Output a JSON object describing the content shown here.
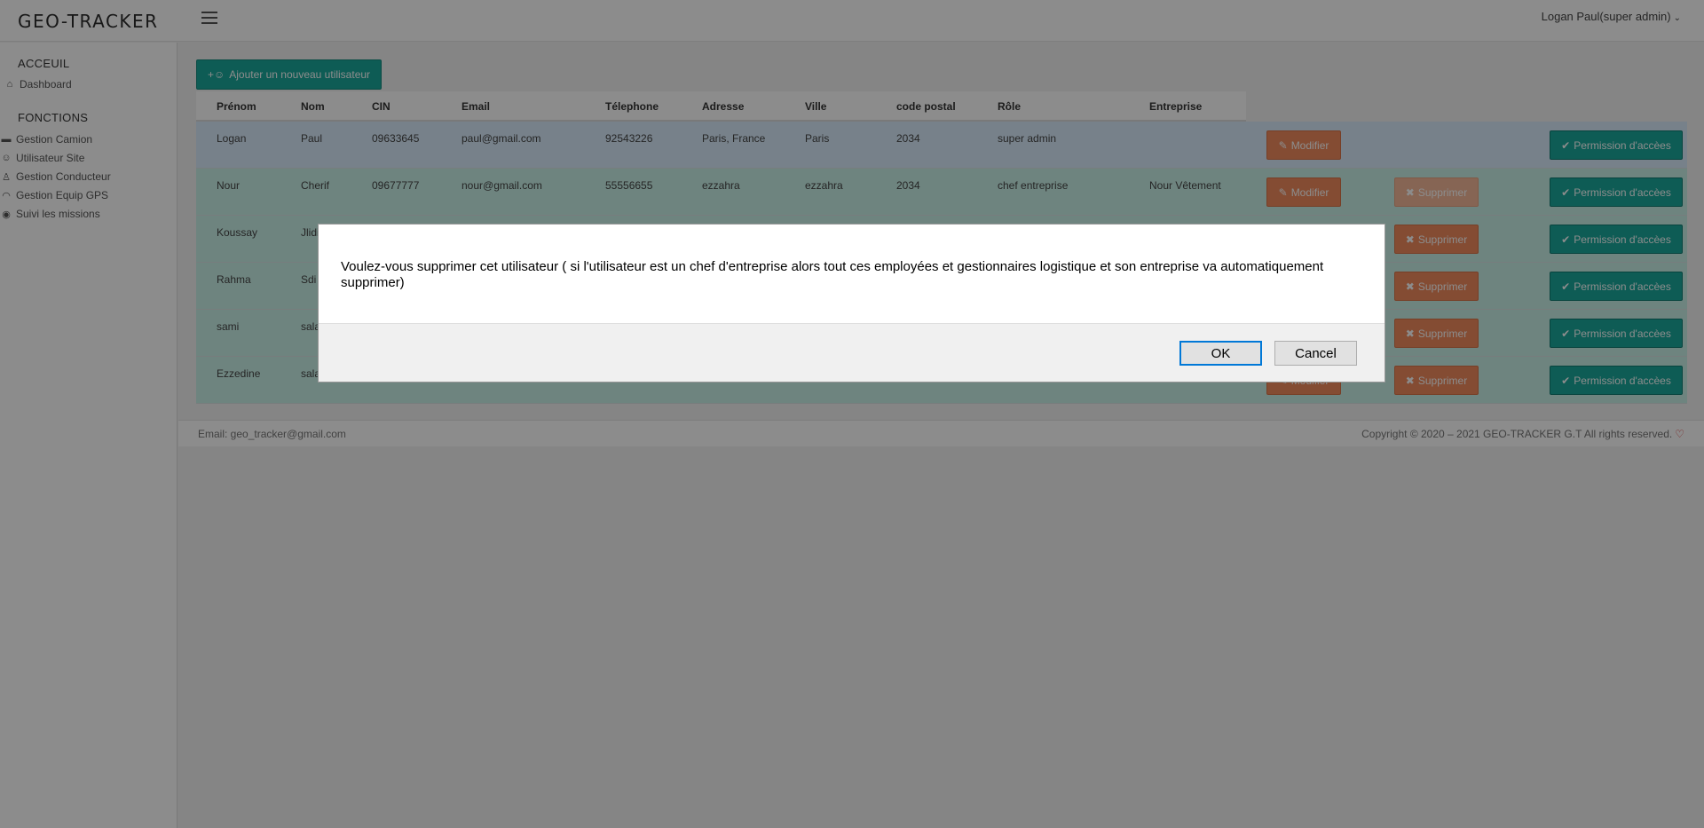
{
  "app": {
    "brand": "GEO-TRACKER"
  },
  "header": {
    "user_label": "Logan Paul(super admin)"
  },
  "sidebar": {
    "sections": [
      {
        "title": "ACCEUIL"
      },
      {
        "title": "FONCTIONS"
      }
    ],
    "items": [
      {
        "label": "Dashboard",
        "icon": "home-icon"
      },
      {
        "label": "Gestion Camion",
        "icon": "truck-icon"
      },
      {
        "label": "Utilisateur Site",
        "icon": "users-icon"
      },
      {
        "label": "Gestion Conducteur",
        "icon": "user-icon"
      },
      {
        "label": "Gestion Equip GPS",
        "icon": "wifi-icon"
      },
      {
        "label": "Suivi les missions",
        "icon": "eye-icon"
      }
    ]
  },
  "main": {
    "add_button": "Ajouter un nouveau utilisateur",
    "columns": [
      "Prénom",
      "Nom",
      "CIN",
      "Email",
      "Télephone",
      "Adresse",
      "Ville",
      "code postal",
      "Rôle",
      "Entreprise"
    ],
    "rows": [
      {
        "prenom": "Logan",
        "nom": "Paul",
        "cin": "09633645",
        "email": "paul@gmail.com",
        "tel": "92543226",
        "adresse": "Paris, France",
        "ville": "Paris",
        "cp": "2034",
        "role": "super admin",
        "entreprise": ""
      },
      {
        "prenom": "Nour",
        "nom": "Cherif",
        "cin": "09677777",
        "email": "nour@gmail.com",
        "tel": "55556655",
        "adresse": "ezzahra",
        "ville": "ezzahra",
        "cp": "2034",
        "role": "chef entreprise",
        "entreprise": "Nour Vêtement"
      },
      {
        "prenom": "Koussay",
        "nom": "Jlidi"
      },
      {
        "prenom": "Rahma",
        "nom": "Sdi"
      },
      {
        "prenom": "sami",
        "nom": "sala"
      },
      {
        "prenom": "Ezzedine",
        "nom": "sala"
      }
    ],
    "modify_label": "Modifier",
    "delete_label": "Supprimer",
    "permission_label": "Permission d'accèes"
  },
  "footer": {
    "email": "Email: geo_tracker@gmail.com",
    "copyright": "Copyright © 2020 – 2021 GEO-TRACKER G.T All rights reserved."
  },
  "dialog": {
    "message": "Voulez-vous supprimer cet utilisateur ( si l'utilisateur est un chef d'entreprise alors tout ces employées et gestionnaires logistique et son entreprise va automatiquement supprimer)",
    "ok": "OK",
    "cancel": "Cancel"
  },
  "colors": {
    "teal": "#1aa89b",
    "orange": "#f08a5d",
    "row_blue": "#d9ecfb",
    "row_green": "#c9f0e8"
  }
}
